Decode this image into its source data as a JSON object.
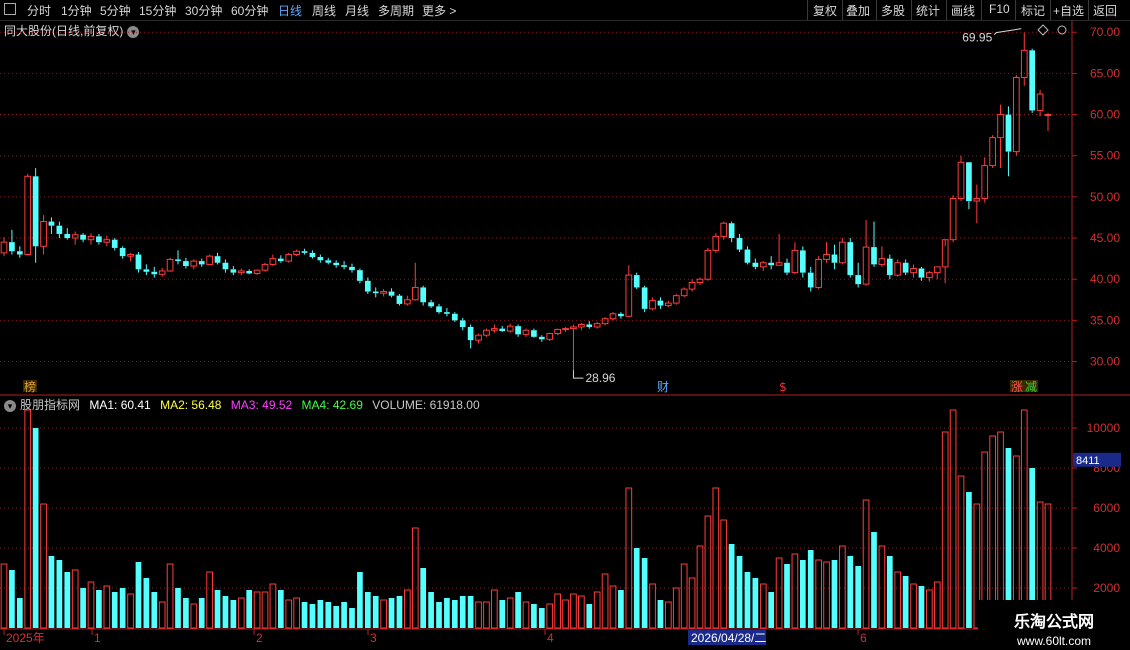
{
  "toolbar": {
    "periods": [
      "分时",
      "1分钟",
      "5分钟",
      "15分钟",
      "30分钟",
      "60分钟",
      "日线",
      "周线",
      "月线",
      "多周期",
      "更多"
    ],
    "active_period": "日线",
    "right_buttons": [
      "复权",
      "叠加",
      "多股",
      "统计",
      "画线",
      "F10",
      "标记",
      "+自选",
      "返回"
    ]
  },
  "stock": {
    "title": "同大股份(日线,前复权)"
  },
  "price_axis": {
    "ticks": [
      "70.00",
      "65.00",
      "60.00",
      "55.00",
      "50.00",
      "45.00",
      "40.00",
      "35.00",
      "30.00"
    ]
  },
  "annotations": {
    "high_label": "69.95",
    "low_label": "28.96"
  },
  "event_markers": [
    {
      "text": "榜",
      "color": "#e0a030"
    },
    {
      "text": "财",
      "color": "#5fa8ff"
    },
    {
      "text": "$",
      "color": "#ff3030"
    },
    {
      "text": "涨",
      "color": "#ff5050"
    },
    {
      "text": "减",
      "color": "#3cd03c"
    }
  ],
  "indicator": {
    "name": "股朋指标网",
    "items": [
      {
        "label": "MA1: 60.41",
        "color": "#ffffff"
      },
      {
        "label": "MA2: 56.48",
        "color": "#ffff40"
      },
      {
        "label": "MA3: 49.52",
        "color": "#ff40ff"
      },
      {
        "label": "MA4: 42.69",
        "color": "#40ff40"
      },
      {
        "label": "VOLUME: 61918.00",
        "color": "#c8c8c8"
      }
    ]
  },
  "volume_axis": {
    "ticks": [
      "10000",
      "8000",
      "6000",
      "4000",
      "2000"
    ],
    "highlight": "8411"
  },
  "date_axis": {
    "labels": [
      "2025年",
      "1",
      "2",
      "3",
      "4",
      "6"
    ],
    "highlight": "2026/04/28/二"
  },
  "watermark": {
    "line1": "乐淘公式网",
    "line2": "www.60lt.com"
  },
  "chart_data": {
    "type": "candlestick",
    "ylim": [
      28,
      71
    ],
    "volume_ylim": [
      0,
      11000
    ],
    "candles": [
      [
        43.2,
        45.1,
        42.8,
        44.5,
        3200
      ],
      [
        44.5,
        46.0,
        43.0,
        43.4,
        2900
      ],
      [
        43.4,
        44.0,
        42.6,
        43.0,
        1500
      ],
      [
        43.0,
        52.8,
        42.9,
        52.5,
        10900
      ],
      [
        52.5,
        53.5,
        42.0,
        44.0,
        10000
      ],
      [
        44.0,
        47.8,
        43.0,
        47.0,
        6200
      ],
      [
        47.0,
        47.5,
        45.5,
        46.5,
        3600
      ],
      [
        46.5,
        47.0,
        45.0,
        45.5,
        3400
      ],
      [
        45.5,
        46.2,
        44.8,
        45.0,
        2800
      ],
      [
        45.0,
        45.8,
        44.2,
        45.4,
        2900
      ],
      [
        45.4,
        45.6,
        44.5,
        44.8,
        2000
      ],
      [
        44.8,
        45.6,
        44.2,
        45.2,
        2300
      ],
      [
        45.2,
        45.5,
        44.2,
        44.5,
        1900
      ],
      [
        44.5,
        45.3,
        44.0,
        44.8,
        2100
      ],
      [
        44.8,
        45.0,
        43.5,
        43.8,
        1800
      ],
      [
        43.8,
        44.0,
        42.5,
        42.8,
        2000
      ],
      [
        42.8,
        43.2,
        42.2,
        43.0,
        1700
      ],
      [
        43.0,
        43.3,
        40.8,
        41.2,
        3300
      ],
      [
        41.2,
        41.8,
        40.5,
        40.9,
        2500
      ],
      [
        40.9,
        41.5,
        40.2,
        40.6,
        1800
      ],
      [
        40.6,
        41.4,
        40.3,
        41.0,
        1300
      ],
      [
        41.0,
        42.6,
        40.9,
        42.4,
        3200
      ],
      [
        42.4,
        43.5,
        41.8,
        42.2,
        2000
      ],
      [
        42.2,
        42.6,
        41.3,
        41.6,
        1500
      ],
      [
        41.6,
        42.4,
        41.2,
        42.2,
        1200
      ],
      [
        42.2,
        42.5,
        41.5,
        41.8,
        1500
      ],
      [
        41.8,
        43.0,
        41.7,
        42.8,
        2800
      ],
      [
        42.8,
        43.2,
        41.8,
        42.0,
        1900
      ],
      [
        42.0,
        42.4,
        40.8,
        41.2,
        1600
      ],
      [
        41.2,
        41.6,
        40.5,
        40.8,
        1400
      ],
      [
        40.8,
        41.3,
        40.5,
        41.0,
        1500
      ],
      [
        41.0,
        41.2,
        40.6,
        40.7,
        1900
      ],
      [
        40.7,
        41.2,
        40.5,
        41.1,
        1800
      ],
      [
        41.1,
        42.0,
        40.9,
        41.8,
        1800
      ],
      [
        41.8,
        43.0,
        41.6,
        42.5,
        2200
      ],
      [
        42.5,
        42.9,
        42.0,
        42.2,
        1900
      ],
      [
        42.2,
        43.2,
        42.0,
        43.0,
        1400
      ],
      [
        43.0,
        43.6,
        42.8,
        43.4,
        1500
      ],
      [
        43.4,
        43.7,
        43.0,
        43.2,
        1300
      ],
      [
        43.2,
        43.5,
        42.5,
        42.7,
        1200
      ],
      [
        42.7,
        43.0,
        42.0,
        42.3,
        1400
      ],
      [
        42.3,
        42.6,
        41.8,
        42.0,
        1300
      ],
      [
        42.0,
        42.3,
        41.4,
        41.7,
        1100
      ],
      [
        41.7,
        42.2,
        41.2,
        41.5,
        1300
      ],
      [
        41.5,
        41.9,
        40.8,
        41.1,
        1000
      ],
      [
        41.1,
        41.3,
        39.5,
        39.8,
        2800
      ],
      [
        39.8,
        40.2,
        38.2,
        38.5,
        1800
      ],
      [
        38.5,
        39.0,
        37.8,
        38.3,
        1600
      ],
      [
        38.3,
        38.8,
        37.9,
        38.5,
        1400
      ],
      [
        38.5,
        38.9,
        37.8,
        38.0,
        1500
      ],
      [
        38.0,
        38.2,
        36.8,
        37.0,
        1600
      ],
      [
        37.0,
        38.0,
        36.8,
        37.5,
        1900
      ],
      [
        37.5,
        42.0,
        37.4,
        39.0,
        5000
      ],
      [
        39.0,
        39.2,
        36.8,
        37.2,
        3000
      ],
      [
        37.2,
        37.5,
        36.5,
        36.7,
        1800
      ],
      [
        36.7,
        37.0,
        35.8,
        36.0,
        1300
      ],
      [
        36.0,
        36.5,
        35.5,
        35.8,
        1500
      ],
      [
        35.8,
        36.0,
        34.8,
        35.0,
        1400
      ],
      [
        35.0,
        35.3,
        33.8,
        34.2,
        1600
      ],
      [
        34.2,
        34.5,
        31.6,
        32.6,
        1600
      ],
      [
        32.6,
        33.4,
        32.2,
        33.2,
        1300
      ],
      [
        33.2,
        34.0,
        33.0,
        33.8,
        1300
      ],
      [
        33.8,
        34.5,
        33.5,
        34.0,
        1900
      ],
      [
        34.0,
        34.3,
        33.6,
        33.7,
        1400
      ],
      [
        33.7,
        34.6,
        33.5,
        34.3,
        1500
      ],
      [
        34.3,
        34.5,
        33.0,
        33.3,
        1800
      ],
      [
        33.3,
        34.0,
        33.0,
        33.8,
        1300
      ],
      [
        33.8,
        34.0,
        32.9,
        33.0,
        1200
      ],
      [
        33.0,
        33.2,
        32.4,
        32.7,
        1000
      ],
      [
        32.7,
        33.5,
        32.5,
        33.4,
        1200
      ],
      [
        33.4,
        34.0,
        33.2,
        33.9,
        1700
      ],
      [
        33.9,
        34.2,
        33.6,
        34.0,
        1400
      ],
      [
        34.0,
        34.5,
        28.96,
        34.2,
        1700
      ],
      [
        34.2,
        34.7,
        33.8,
        34.5,
        1600
      ],
      [
        34.5,
        34.9,
        34.0,
        34.2,
        1200
      ],
      [
        34.2,
        34.8,
        34.0,
        34.6,
        1800
      ],
      [
        34.6,
        35.4,
        34.4,
        35.2,
        2700
      ],
      [
        35.2,
        36.0,
        35.0,
        35.8,
        2100
      ],
      [
        35.8,
        36.0,
        35.2,
        35.5,
        1900
      ],
      [
        35.5,
        41.7,
        35.4,
        40.5,
        7000
      ],
      [
        40.5,
        40.8,
        38.8,
        39.0,
        4000
      ],
      [
        39.0,
        39.2,
        36.0,
        36.4,
        3500
      ],
      [
        36.4,
        37.8,
        36.2,
        37.4,
        2200
      ],
      [
        37.4,
        37.8,
        36.4,
        36.8,
        1400
      ],
      [
        36.8,
        37.4,
        36.6,
        37.1,
        1300
      ],
      [
        37.1,
        38.2,
        36.9,
        38.0,
        2000
      ],
      [
        38.0,
        39.0,
        37.8,
        38.8,
        3200
      ],
      [
        38.8,
        40.0,
        38.5,
        39.6,
        2500
      ],
      [
        39.6,
        40.2,
        39.3,
        40.0,
        4100
      ],
      [
        40.0,
        43.8,
        39.8,
        43.5,
        5600
      ],
      [
        43.5,
        45.6,
        43.2,
        45.2,
        7000
      ],
      [
        45.2,
        47.0,
        44.8,
        46.8,
        5400
      ],
      [
        46.8,
        47.0,
        44.5,
        45.0,
        4200
      ],
      [
        45.0,
        45.5,
        43.3,
        43.6,
        3600
      ],
      [
        43.6,
        44.0,
        41.8,
        42.0,
        2800
      ],
      [
        42.0,
        42.5,
        41.2,
        41.5,
        2500
      ],
      [
        41.5,
        42.2,
        41.0,
        42.0,
        2200
      ],
      [
        42.0,
        42.8,
        41.2,
        41.7,
        1800
      ],
      [
        41.7,
        45.5,
        41.6,
        42.0,
        3500
      ],
      [
        42.0,
        42.5,
        40.5,
        40.8,
        3200
      ],
      [
        40.8,
        44.5,
        40.6,
        43.5,
        3700
      ],
      [
        43.5,
        44.0,
        40.2,
        40.8,
        3400
      ],
      [
        40.8,
        41.5,
        38.5,
        39.0,
        3900
      ],
      [
        39.0,
        42.8,
        38.8,
        42.4,
        3400
      ],
      [
        42.4,
        44.5,
        42.0,
        43.0,
        3300
      ],
      [
        43.0,
        44.2,
        41.2,
        42.0,
        3400
      ],
      [
        42.0,
        45.0,
        41.8,
        44.5,
        4100
      ],
      [
        44.5,
        45.0,
        40.2,
        40.5,
        3600
      ],
      [
        40.5,
        42.0,
        39.0,
        39.4,
        3100
      ],
      [
        39.4,
        47.2,
        39.2,
        43.9,
        6400
      ],
      [
        43.9,
        47.0,
        41.5,
        41.8,
        4800
      ],
      [
        41.8,
        44.0,
        41.5,
        42.5,
        4100
      ],
      [
        42.5,
        43.0,
        40.0,
        40.5,
        3600
      ],
      [
        40.5,
        42.4,
        40.3,
        42.0,
        2800
      ],
      [
        42.0,
        42.4,
        40.5,
        40.8,
        2600
      ],
      [
        40.8,
        41.8,
        40.2,
        41.3,
        2200
      ],
      [
        41.3,
        41.5,
        39.8,
        40.2,
        2100
      ],
      [
        40.2,
        41.0,
        39.7,
        40.8,
        1900
      ],
      [
        40.8,
        41.5,
        40.0,
        41.5,
        2300
      ],
      [
        41.5,
        44.0,
        39.5,
        44.8,
        9800
      ],
      [
        44.8,
        50.2,
        44.5,
        49.8,
        10900
      ],
      [
        49.8,
        55.0,
        49.5,
        54.2,
        7600
      ],
      [
        54.2,
        53.5,
        48.5,
        49.5,
        6800
      ],
      [
        49.5,
        51.5,
        46.8,
        49.8,
        6200
      ],
      [
        49.8,
        54.8,
        49.3,
        53.8,
        8800
      ],
      [
        53.8,
        57.5,
        53.5,
        57.2,
        9600
      ],
      [
        57.2,
        61.2,
        53.5,
        60.0,
        9800
      ],
      [
        60.0,
        61.0,
        52.5,
        55.5,
        9000
      ],
      [
        55.5,
        64.8,
        55.0,
        64.5,
        8600
      ],
      [
        64.5,
        69.95,
        63.5,
        67.8,
        10900
      ],
      [
        67.8,
        68.0,
        60.2,
        60.5,
        8000
      ],
      [
        60.5,
        63.0,
        59.8,
        62.5,
        6300
      ],
      [
        60.0,
        60.2,
        58.0,
        60.0,
        6200
      ]
    ]
  }
}
